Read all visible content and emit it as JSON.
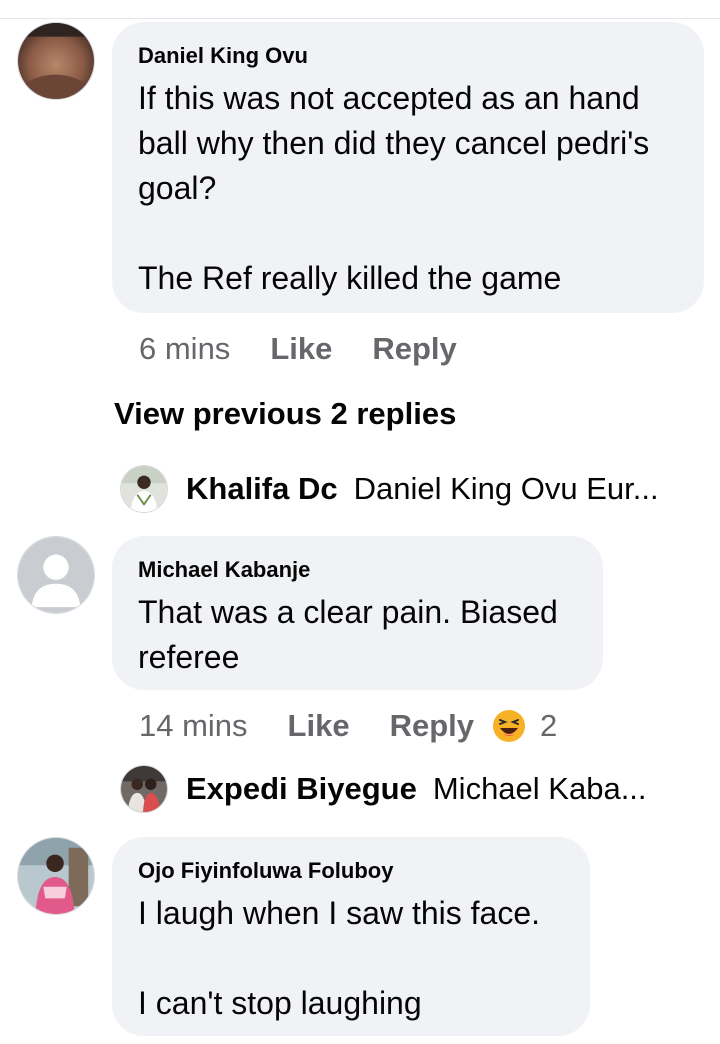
{
  "comments": [
    {
      "author": "Daniel King Ovu",
      "lines": [
        "If this was not accepted as an hand",
        "ball why then did they cancel pedri's",
        "goal?",
        "",
        "The Ref really killed the game"
      ],
      "time": "6 mins",
      "like_label": "Like",
      "reply_label": "Reply"
    },
    {
      "author": "Michael Kabanje",
      "lines": [
        "That was a clear pain. Biased",
        "referee"
      ],
      "time": "14 mins",
      "like_label": "Like",
      "reply_label": "Reply",
      "reaction_icon": "laughing-emoji-icon",
      "reaction_count": "2"
    },
    {
      "author": "Ojo Fiyinfoluwa Foluboy",
      "lines": [
        "I laugh when I saw this face.",
        "",
        "I can't stop laughing"
      ]
    }
  ],
  "view_previous_replies": "View previous 2 replies",
  "reply_previews": [
    {
      "name": "Khalifa Dc",
      "preview": "Daniel King Ovu Eur..."
    },
    {
      "name": "Expedi Biyegue",
      "preview": "Michael Kaba..."
    }
  ],
  "colors": {
    "bubble": "#f0f2f5",
    "meta_text": "#65676b",
    "text": "#050505",
    "emoji": "#f7b125"
  }
}
